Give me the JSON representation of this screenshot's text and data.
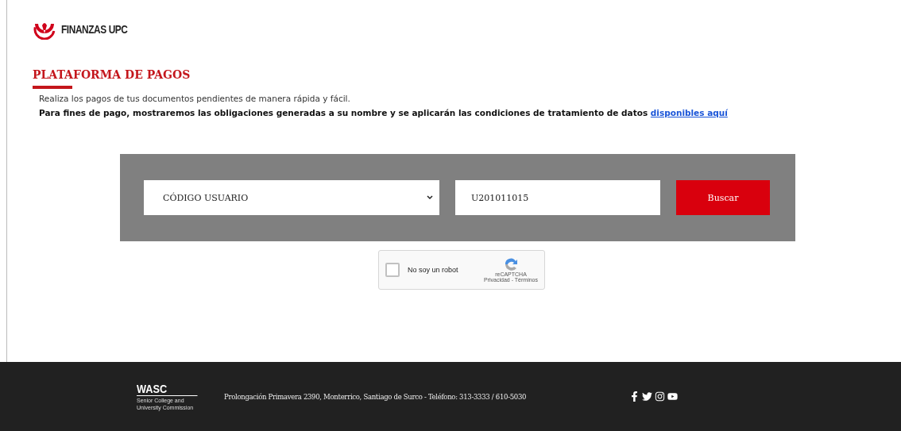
{
  "header": {
    "brand": "FINANZAS UPC"
  },
  "section": {
    "title": "PLATAFORMA DE PAGOS",
    "intro": "Realiza los pagos de tus documentos pendientes de manera rápida y fácil.",
    "notice": "Para fines de pago, mostraremos las obligaciones generadas a su nombre y se aplicarán las condiciones de tratamiento de datos",
    "notice_link": "disponibles aquí"
  },
  "search": {
    "type_select": "CÓDIGO USUARIO",
    "code_value": "U201011015",
    "button": "Buscar"
  },
  "captcha": {
    "checked": false,
    "label": "No soy un robot",
    "brand": "reCAPTCHA",
    "terms": "Privacidad - Términos"
  },
  "footer": {
    "wasc_title": "WASC",
    "wasc_subtitle": "Senior College and University Commission",
    "address": "Prolongación Primavera 2390, Monterrico, Santiago de Surco - Teléfono: 313-3333 / 610-5030",
    "social": [
      {
        "kind": "facebook"
      },
      {
        "kind": "twitter"
      },
      {
        "kind": "instagram"
      },
      {
        "kind": "youtube"
      }
    ]
  }
}
